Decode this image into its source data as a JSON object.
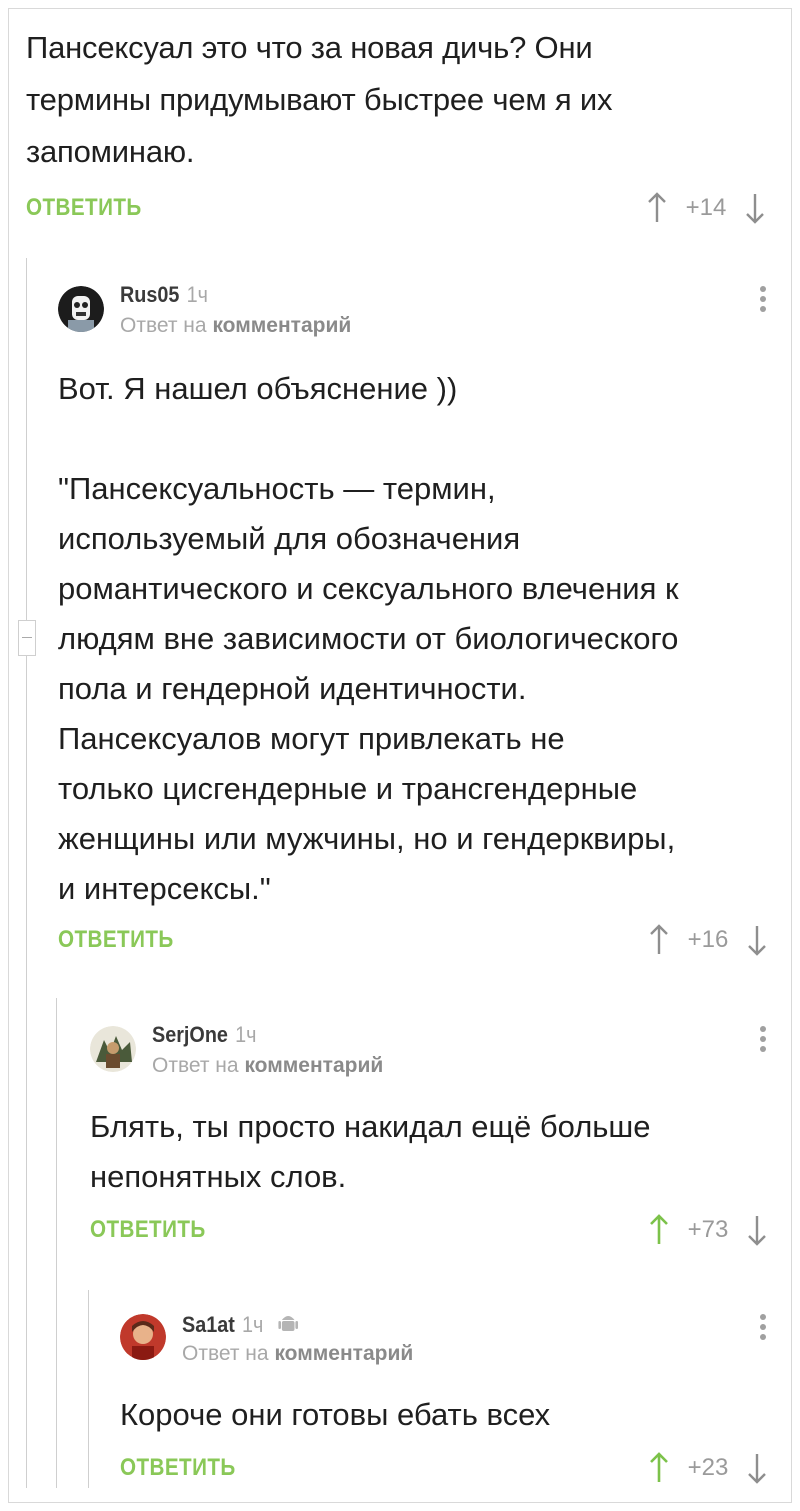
{
  "top_comment": {
    "text_lines": [
      "Пансексуал это что за новая дичь? Они",
      "термины придумывают быстрее чем я их",
      "запоминаю."
    ],
    "reply_label": "ОТВЕТИТЬ",
    "score": "+14"
  },
  "replies": [
    {
      "username": "Rus05",
      "time": "1ч",
      "reply_prefix": "Ответ на",
      "reply_target": "комментарий",
      "text_lines": [
        "Вот. Я нашел объяснение ))",
        "",
        "\"Пансексуальность — термин,",
        "используемый для обозначения",
        "романтического и сексуального влечения к",
        "людям вне зависимости от биологического",
        "пола и гендерной идентичности.",
        "Пансексуалов могут привлекать не",
        "только цисгендерные и трансгендерные",
        "женщины или мужчины, но и гендерквиры,",
        "и интерсексы.\""
      ],
      "reply_label": "ОТВЕТИТЬ",
      "score": "+16"
    },
    {
      "username": "SerjOne",
      "time": "1ч",
      "reply_prefix": "Ответ на",
      "reply_target": "комментарий",
      "text_lines": [
        "Блять, ты просто накидал ещё больше",
        "непонятных слов."
      ],
      "reply_label": "ОТВЕТИТЬ",
      "score": "+73"
    },
    {
      "username": "Sa1at",
      "time": "1ч",
      "reply_prefix": "Ответ на",
      "reply_target": "комментарий",
      "text_lines": [
        "Короче они готовы ебать всех"
      ],
      "reply_label": "ОТВЕТИТЬ",
      "score": "+23"
    }
  ],
  "colors": {
    "reply_green": "#8ac858",
    "upvoted_green": "#7cc24a",
    "arrow_gray": "#8e8e8e"
  },
  "icons": [
    "arrow-up-icon",
    "arrow-down-icon",
    "more-vertical-icon",
    "android-icon",
    "collapse-thread-icon"
  ]
}
